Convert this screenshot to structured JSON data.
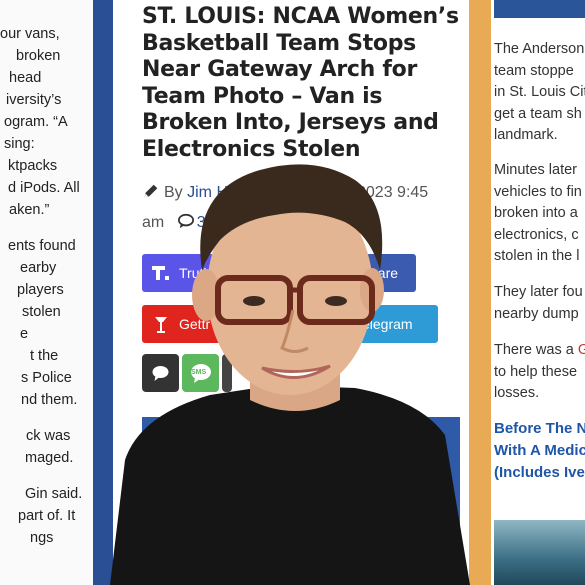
{
  "left_column": {
    "paragraphs": [
      [
        "our vans,",
        "broken",
        "head",
        "iversity’s",
        "ogram. “A",
        "sing:",
        "ktpacks",
        "d iPods. All",
        "aken.”"
      ],
      [
        "ents found",
        "earby",
        "players",
        "stolen",
        "e",
        "t the",
        "s Police",
        "nd them."
      ],
      [
        "ck was",
        "maged."
      ],
      [
        "Gin said.",
        "part of. It",
        "ngs"
      ]
    ]
  },
  "article": {
    "headline_lines": [
      "ST. LOUIS: NCAA Women’s",
      "Basketball Team Stops",
      "Near Gateway Arch for",
      "Team Photo – Van is",
      "Broken Into, Jerseys and",
      "Electronics Stolen"
    ],
    "byline_prefix": "By",
    "author": "Jim H",
    "date_fragment": "2023 9:45",
    "time_fragment": "am",
    "comment_count": "3",
    "share_buttons": {
      "truth_label": "Truth",
      "share_label": "hare",
      "gettr_label": "Gettr",
      "telegram_label": "elegram"
    },
    "sms_label": "SMS"
  },
  "right_column": {
    "paragraphs": [
      [
        "The Anderson",
        "team stoppe",
        "in St. Louis Cit",
        "get a team sh",
        "landmark."
      ],
      [
        "Minutes later",
        "vehicles to fin",
        "broken into a",
        "electronics, c",
        "stolen in the l"
      ],
      [
        "They later fou",
        "nearby dump"
      ],
      [
        "There was a",
        "to help these",
        "losses."
      ]
    ],
    "link_fragment": "G",
    "headline_link_lines": [
      "Before The Ne",
      "With A Medic",
      "(Includes Ive"
    ]
  },
  "colors": {
    "blue_strip": "#2a4f94",
    "gold_strip": "#e9aa55",
    "truth": "#5a55e8",
    "gettr": "#e0241e",
    "telegram": "#2e9bd6",
    "share": "#3b5bb0",
    "comment_btn": "#333333",
    "sms_btn": "#5cb85c"
  }
}
